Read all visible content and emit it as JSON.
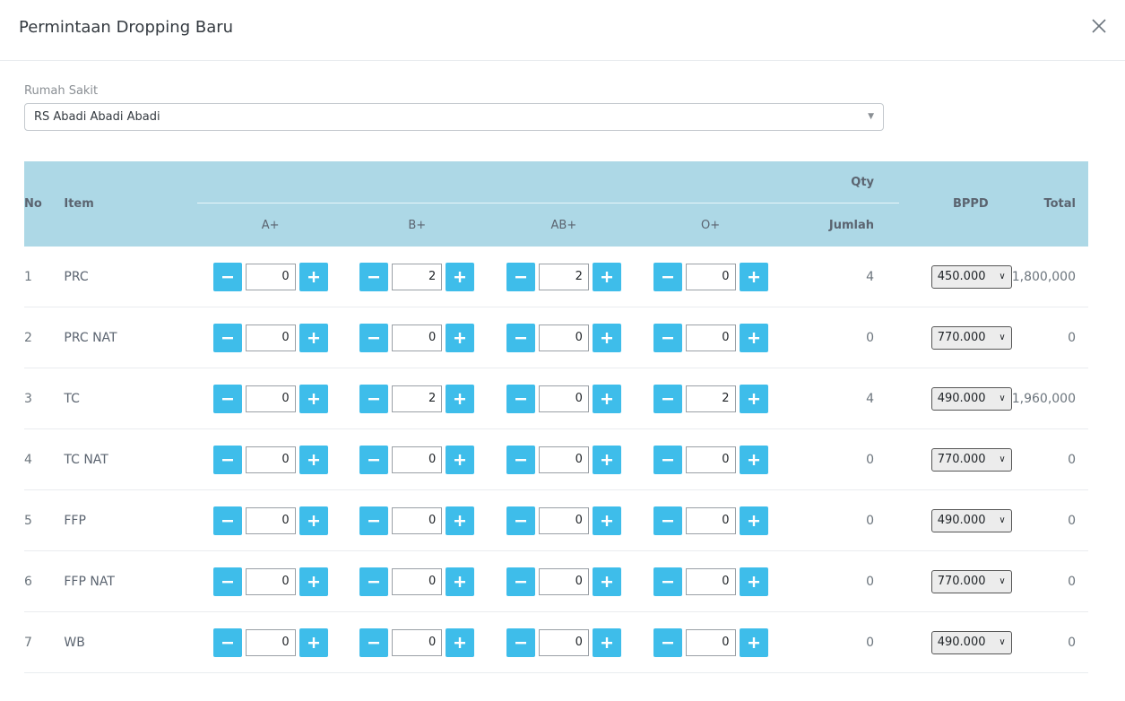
{
  "modal": {
    "title": "Permintaan Dropping Baru"
  },
  "form": {
    "hospital_label": "Rumah Sakit",
    "hospital_value": "RS Abadi Abadi Abadi"
  },
  "table": {
    "headers": {
      "no": "No",
      "item": "Item",
      "qty": "Qty",
      "a": "A+",
      "b": "B+",
      "ab": "AB+",
      "o": "O+",
      "jumlah": "Jumlah",
      "bppd": "BPPD",
      "total": "Total"
    },
    "rows": [
      {
        "no": "1",
        "item": "PRC",
        "a": "0",
        "b": "2",
        "ab": "2",
        "o": "0",
        "jumlah": "4",
        "bppd": "450.000",
        "total": "1,800,000"
      },
      {
        "no": "2",
        "item": "PRC NAT",
        "a": "0",
        "b": "0",
        "ab": "0",
        "o": "0",
        "jumlah": "0",
        "bppd": "770.000",
        "total": "0"
      },
      {
        "no": "3",
        "item": "TC",
        "a": "0",
        "b": "2",
        "ab": "0",
        "o": "2",
        "jumlah": "4",
        "bppd": "490.000",
        "total": "1,960,000"
      },
      {
        "no": "4",
        "item": "TC NAT",
        "a": "0",
        "b": "0",
        "ab": "0",
        "o": "0",
        "jumlah": "0",
        "bppd": "770.000",
        "total": "0"
      },
      {
        "no": "5",
        "item": "FFP",
        "a": "0",
        "b": "0",
        "ab": "0",
        "o": "0",
        "jumlah": "0",
        "bppd": "490.000",
        "total": "0"
      },
      {
        "no": "6",
        "item": "FFP NAT",
        "a": "0",
        "b": "0",
        "ab": "0",
        "o": "0",
        "jumlah": "0",
        "bppd": "770.000",
        "total": "0"
      },
      {
        "no": "7",
        "item": "WB",
        "a": "0",
        "b": "0",
        "ab": "0",
        "o": "0",
        "jumlah": "0",
        "bppd": "490.000",
        "total": "0"
      }
    ]
  },
  "colors": {
    "header_bg": "#add8e6",
    "stepper_button": "#3ebdea"
  },
  "icons": {
    "close": "close-icon",
    "minus": "minus-icon",
    "plus": "plus-icon",
    "caret": "caret-down-icon"
  }
}
